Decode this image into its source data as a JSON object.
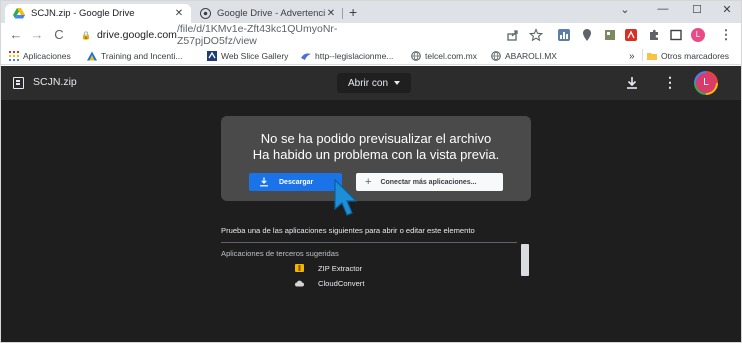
{
  "browser": {
    "tabs": [
      {
        "title": "SCJN.zip - Google Drive",
        "close": "✕",
        "favicon": "google-drive-icon"
      },
      {
        "title": "Google Drive - Advertencia de a",
        "close": "✕",
        "favicon": "chrome-icon"
      }
    ],
    "new_tab": "+",
    "window_controls": {
      "minimize": "—",
      "maximize": "☐",
      "close": "✕",
      "tab_search": "⌄"
    },
    "url": {
      "host": "drive.google.com",
      "path": "/file/d/1KMv1e-Zft43kc1QUmyoNr-Z57pjDO5fz/view"
    },
    "bookmarks": [
      {
        "label": "Aplicaciones",
        "icon": "apps-grid-icon"
      },
      {
        "label": "Training and Incenti...",
        "icon": "triangle-logo-icon"
      },
      {
        "label": "Web Slice Gallery",
        "icon": "web-slice-icon"
      },
      {
        "label": "http--legislacionme...",
        "icon": "bird-icon"
      },
      {
        "label": "telcel.com.mx",
        "icon": "globe-icon"
      },
      {
        "label": "ABAROLI.MX",
        "icon": "globe-icon"
      }
    ],
    "bookmarks_overflow": "»",
    "other_bookmarks": "Otros marcadores"
  },
  "viewer": {
    "file_name": "SCJN.zip",
    "open_with": "Abrir con",
    "avatar_initial": "L",
    "more": "⋮",
    "error_line1": "No se ha podido previsualizar el archivo",
    "error_line2": "Ha habido un problema con la vista previa.",
    "download_label": "Descargar",
    "connect_label": "Conectar más aplicaciones...",
    "connect_plus": "+",
    "suggest_text": "Prueba una de las aplicaciones siguientes para abrir o editar este elemento",
    "third_party_title": "Aplicaciones de terceros sugeridas",
    "apps": [
      {
        "name": "ZIP Extractor",
        "icon": "zip-extractor-icon"
      },
      {
        "name": "CloudConvert",
        "icon": "cloudconvert-icon"
      }
    ]
  },
  "colors": {
    "accent": "#1a73e8",
    "viewer_bg": "#1e1e1e",
    "header_bg": "#2c2c2c",
    "dialog_bg": "#4a4a4a",
    "tabstrip_bg": "#dee1e6"
  }
}
